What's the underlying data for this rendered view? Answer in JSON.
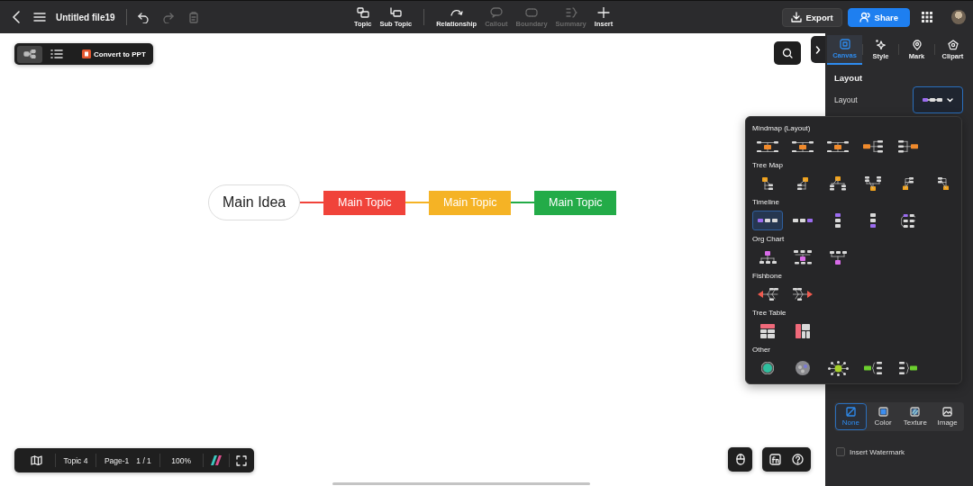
{
  "top_bar": {
    "title": "Untitled file19",
    "history_buttons": [
      {
        "kind": "undo",
        "disabled": false
      },
      {
        "kind": "redo",
        "disabled": true
      },
      {
        "kind": "paste",
        "disabled": true
      }
    ],
    "tools": [
      {
        "kind": "topic",
        "label": "Topic",
        "disabled": false,
        "separator_before": false
      },
      {
        "kind": "subtopic",
        "label": "Sub Topic",
        "disabled": false,
        "separator_before": false
      },
      {
        "kind": "relationship",
        "label": "Relationship",
        "disabled": false,
        "separator_before": true
      },
      {
        "kind": "callout",
        "label": "Callout",
        "disabled": true,
        "separator_before": false
      },
      {
        "kind": "boundary",
        "label": "Boundary",
        "disabled": true,
        "separator_before": false
      },
      {
        "kind": "summary",
        "label": "Summary",
        "disabled": true,
        "separator_before": false
      },
      {
        "kind": "insert",
        "label": "Insert",
        "disabled": false,
        "separator_before": false
      }
    ],
    "export": "Export",
    "share": "Share"
  },
  "canvas_toolbar": {
    "views": [
      {
        "kind": "mindmap",
        "selected": true
      },
      {
        "kind": "outline",
        "selected": false
      }
    ],
    "convert": "Convert to PPT"
  },
  "mind_map": {
    "root": "Main Idea",
    "topics": [
      {
        "label": "Main Topic",
        "color": "#f0433a"
      },
      {
        "label": "Main Topic",
        "color": "#f5b325"
      },
      {
        "label": "Main Topic",
        "color": "#23ab48"
      }
    ]
  },
  "bottom_bar": {
    "topic_count": "Topic 4",
    "page_name": "Page-1",
    "page_count": "1 / 1",
    "zoom": "100%"
  },
  "side_panel": {
    "tabs": [
      {
        "kind": "canvas",
        "label": "Canvas",
        "selected": true
      },
      {
        "kind": "style",
        "label": "Style",
        "selected": false
      },
      {
        "kind": "mark",
        "label": "Mark",
        "selected": false
      },
      {
        "kind": "clipart",
        "label": "Clipart",
        "selected": false
      }
    ],
    "section_title": "Layout",
    "layout_label": "Layout",
    "background_options": [
      {
        "kind": "none",
        "label": "None",
        "selected": true
      },
      {
        "kind": "color",
        "label": "Color",
        "selected": false
      },
      {
        "kind": "texture",
        "label": "Texture",
        "selected": false
      },
      {
        "kind": "image",
        "label": "Image",
        "selected": false
      }
    ],
    "watermark": {
      "label": "Insert Watermark",
      "checked": false
    }
  },
  "layout_popover": {
    "groups": [
      {
        "title": "Mindmap (Layout)",
        "options": [
          {
            "kind": "mind-both",
            "selected": false
          },
          {
            "kind": "mind-both",
            "selected": false
          },
          {
            "kind": "mind-both",
            "selected": false
          },
          {
            "kind": "mind-right",
            "selected": false
          },
          {
            "kind": "mind-left",
            "selected": false
          }
        ]
      },
      {
        "title": "Tree Map",
        "options": [
          {
            "kind": "tree-tl",
            "selected": false
          },
          {
            "kind": "tree-tr",
            "selected": false
          },
          {
            "kind": "tree-tc",
            "selected": false
          },
          {
            "kind": "tree-bc",
            "selected": false
          },
          {
            "kind": "tree-bl",
            "selected": false
          },
          {
            "kind": "tree-br",
            "selected": false
          }
        ]
      },
      {
        "title": "Timeline",
        "options": [
          {
            "kind": "tl-h-start",
            "selected": true
          },
          {
            "kind": "tl-h-end",
            "selected": false
          },
          {
            "kind": "tl-v-start",
            "selected": false
          },
          {
            "kind": "tl-v-end",
            "selected": false
          },
          {
            "kind": "tl-wind",
            "selected": false
          }
        ]
      },
      {
        "title": "Org Chart",
        "options": [
          {
            "kind": "org-down",
            "selected": false
          },
          {
            "kind": "org-down-wide",
            "selected": false
          },
          {
            "kind": "org-up",
            "selected": false
          }
        ]
      },
      {
        "title": "Fishbone",
        "options": [
          {
            "kind": "fish-left",
            "selected": false
          },
          {
            "kind": "fish-right",
            "selected": false
          }
        ]
      },
      {
        "title": "Tree Table",
        "options": [
          {
            "kind": "table-rows",
            "selected": false
          },
          {
            "kind": "table-cols",
            "selected": false
          }
        ]
      },
      {
        "title": "Other",
        "options": [
          {
            "kind": "ring",
            "selected": false
          },
          {
            "kind": "bubble",
            "selected": false
          },
          {
            "kind": "radial",
            "selected": false
          },
          {
            "kind": "bracket-left",
            "selected": false
          },
          {
            "kind": "bracket-right",
            "selected": false
          }
        ]
      }
    ]
  }
}
